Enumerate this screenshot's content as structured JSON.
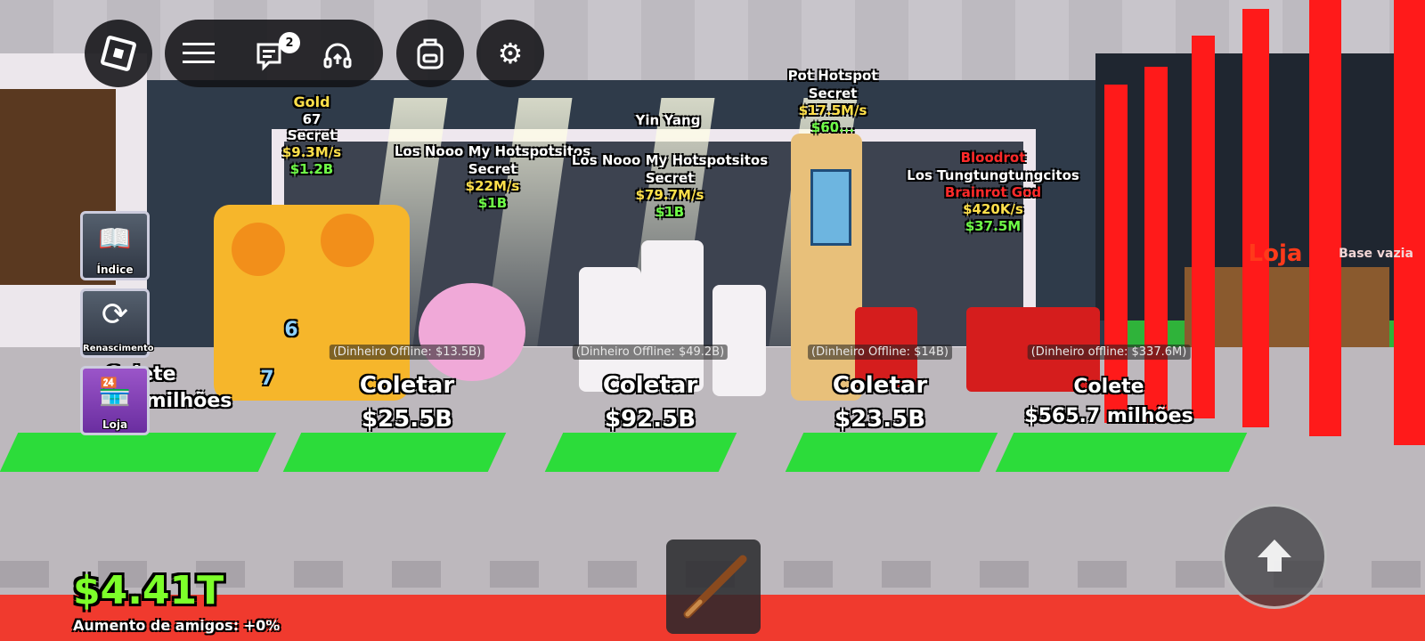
{
  "topbar": {
    "roblox_menu_label": "",
    "chat_badge": "2"
  },
  "side_buttons": [
    {
      "label": "Índice",
      "icon": "book-icon"
    },
    {
      "label": "Renascimento",
      "icon": "rebirth-icon"
    },
    {
      "label": "Loja",
      "icon": "shop-icon"
    }
  ],
  "brainrots": [
    {
      "mutation": "Gold",
      "count": "67",
      "rarity": "Secret",
      "rate": "$9.3M/s",
      "price": "$1.2B"
    },
    {
      "name": "Los Nooo My Hotspotsitos",
      "rarity": "Secret",
      "rate": "$22M/s",
      "price": "$1B"
    },
    {
      "trait": "Yin Yang",
      "name": "Los Nooo My Hotspotsitos",
      "rarity": "Secret",
      "rate": "$79.7M/s",
      "price": "$1B"
    },
    {
      "name": "Pot Hotspot",
      "rarity": "Secret",
      "rate": "$17.5M/s",
      "price": "$60..."
    },
    {
      "mutation": "Bloodrot",
      "name": "Los Tungtungtungcitos",
      "rarity": "Brainrot God",
      "rate": "$420K/s",
      "price": "$37.5M"
    }
  ],
  "collect_stations": [
    {
      "offline": "",
      "action": "Colete",
      "amount": "milhões"
    },
    {
      "offline": "(Dinheiro Offline: $13.5B)",
      "action": "Coletar",
      "amount": "$25.5B"
    },
    {
      "offline": "(Dinheiro Offline: $49.2B)",
      "action": "Coletar",
      "amount": "$92.5B"
    },
    {
      "offline": "(Dinheiro Offline: $14B)",
      "action": "Coletar",
      "amount": "$23.5B"
    },
    {
      "offline": "(Dinheiro offline: $337.6M)",
      "action": "Colete",
      "amount": "$565.7 milhões"
    }
  ],
  "world_signs": {
    "shop_sign": "Loja",
    "base_sign": "Base vazia",
    "floor_numbers": [
      "6",
      "7"
    ]
  },
  "hud": {
    "money": "$4.41T",
    "friends_boost": "Aumento de amigos: +0%"
  },
  "hotbar": {
    "slot1_tool": "bat-icon"
  },
  "colors": {
    "money_green": "#7dff2a",
    "pad_green": "#2cdc3a",
    "floor_red": "#f03a2e",
    "rarity_yellow": "#ffe04a"
  }
}
